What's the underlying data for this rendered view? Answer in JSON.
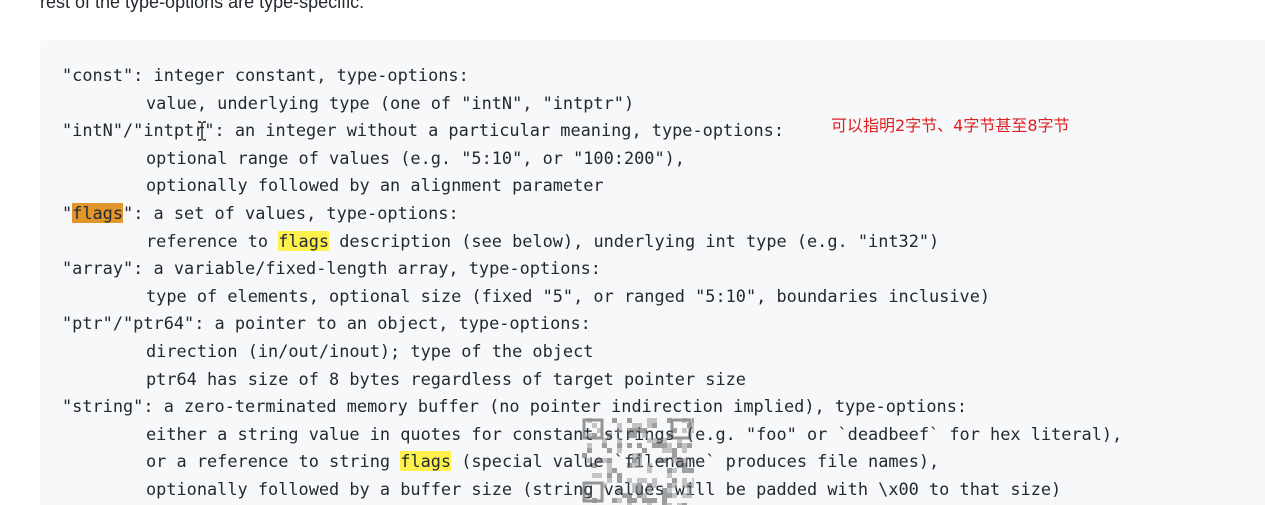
{
  "intro_text": "rest of the type-options are type-specific:",
  "code_lines": [
    {
      "indent": false,
      "segments": [
        {
          "t": "\"const\": integer constant, type-options:"
        }
      ]
    },
    {
      "indent": true,
      "segments": [
        {
          "t": "value, underlying type (one of \"intN\", \"intptr\")"
        }
      ]
    },
    {
      "indent": false,
      "segments": [
        {
          "t": "\"intN\"/\"intptr\": an integer without a particular meaning, type-options:"
        }
      ]
    },
    {
      "indent": true,
      "segments": [
        {
          "t": "optional range of values (e.g. \"5:10\", or \"100:200\"),"
        }
      ]
    },
    {
      "indent": true,
      "segments": [
        {
          "t": "optionally followed by an alignment parameter"
        }
      ]
    },
    {
      "indent": false,
      "segments": [
        {
          "t": "\""
        },
        {
          "t": "flags",
          "hl": "active"
        },
        {
          "t": "\": a set of values, type-options:"
        }
      ]
    },
    {
      "indent": true,
      "segments": [
        {
          "t": "reference to "
        },
        {
          "t": "flags",
          "hl": "match"
        },
        {
          "t": " description (see below), underlying int type (e.g. \"int32\")"
        }
      ]
    },
    {
      "indent": false,
      "segments": [
        {
          "t": "\"array\": a variable/fixed-length array, type-options:"
        }
      ]
    },
    {
      "indent": true,
      "segments": [
        {
          "t": "type of elements, optional size (fixed \"5\", or ranged \"5:10\", boundaries inclusive)"
        }
      ]
    },
    {
      "indent": false,
      "segments": [
        {
          "t": "\"ptr\"/\"ptr64\": a pointer to an object, type-options:"
        }
      ]
    },
    {
      "indent": true,
      "segments": [
        {
          "t": "direction (in/out/inout); type of the object"
        }
      ]
    },
    {
      "indent": true,
      "segments": [
        {
          "t": "ptr64 has size of 8 bytes regardless of target pointer size"
        }
      ]
    },
    {
      "indent": false,
      "segments": [
        {
          "t": "\"string\": a zero-terminated memory buffer (no pointer indirection implied), type-options:"
        }
      ]
    },
    {
      "indent": true,
      "segments": [
        {
          "t": "either a string value in quotes for constant strings (e.g. \"foo\" or `deadbeef` for hex literal),"
        }
      ]
    },
    {
      "indent": true,
      "segments": [
        {
          "t": "or a reference to string "
        },
        {
          "t": "flags",
          "hl": "match"
        },
        {
          "t": " (special value `filename` produces file names),"
        }
      ]
    },
    {
      "indent": true,
      "segments": [
        {
          "t": "optionally followed by a buffer size (string values will be padded with \\x00 to that size)"
        }
      ]
    }
  ],
  "annotation": "可以指明2字节、4字节甚至8字节",
  "colors": {
    "code_background": "#f6f8fa",
    "highlight_match": "#fff14d",
    "highlight_active": "#e2952b",
    "annotation": "#e02020"
  },
  "icons": {
    "cursor": "text-cursor-icon",
    "overlay": "qr-code-watermark"
  }
}
